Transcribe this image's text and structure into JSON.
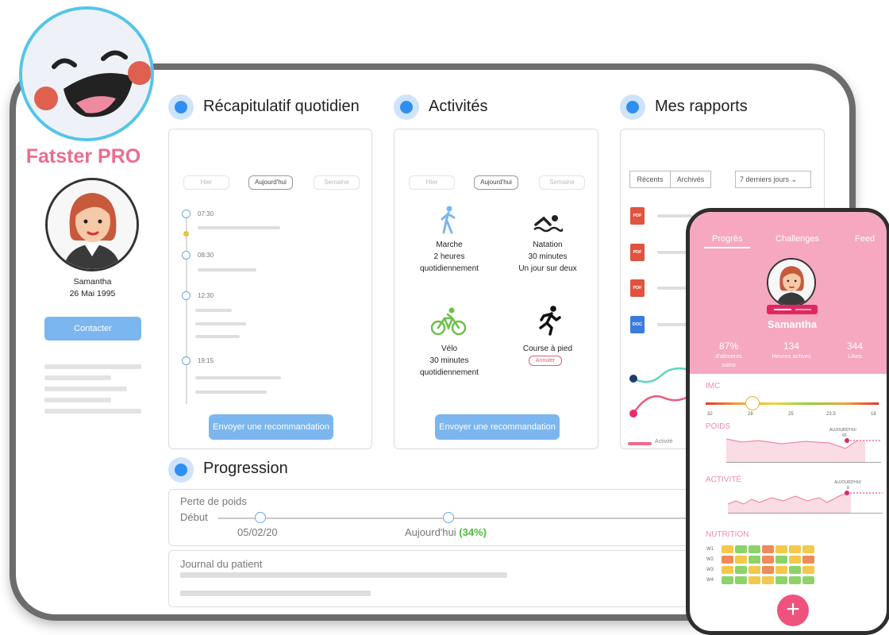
{
  "brand": {
    "name": "Fatster PRO"
  },
  "patient": {
    "name": "Samantha",
    "birthdate": "26 Mai 1995",
    "contact_label": "Contacter"
  },
  "sections": {
    "daily": "Récapitulatif quotidien",
    "activities": "Activités",
    "reports": "Mes rapports",
    "progression": "Progression"
  },
  "daily": {
    "pills": [
      "Hier",
      "Aujourd'hui",
      "Semaine"
    ],
    "times": [
      "07:30",
      "08:30",
      "12:30",
      "19:15"
    ],
    "button": "Envoyer une recommandation"
  },
  "activities": {
    "pills": [
      "Hier",
      "Aujourd'hui",
      "Semaine"
    ],
    "items": [
      {
        "name": "Marche",
        "line1": "2 heures",
        "line2": "quotidiennement",
        "icon": "walking-icon"
      },
      {
        "name": "Natation",
        "line1": "30 minutes",
        "line2": "Un jour sur deux",
        "icon": "swimming-icon"
      },
      {
        "name": "Vélo",
        "line1": "30 minutes",
        "line2": "quotidiennement",
        "icon": "cycling-icon"
      },
      {
        "name": "Course à pied",
        "line1": "Annuler",
        "line2": "",
        "icon": "running-icon"
      }
    ],
    "button": "Envoyer une recommandation"
  },
  "reports": {
    "tabs": [
      "Récents",
      "Archivés"
    ],
    "period": "7 derniers jours",
    "files": [
      "PDF",
      "PDF",
      "PDF",
      "DOC"
    ],
    "legend": "Activité"
  },
  "progression": {
    "weight_label": "Perte de poids",
    "start_label": "Début",
    "start_date": "05/02/20",
    "today_label": "Aujourd'hui",
    "today_pct": "(34%)",
    "journal_label": "Journal du patient"
  },
  "phone": {
    "tabs": [
      "Progrès",
      "Challenges",
      "Feed"
    ],
    "name": "Samantha",
    "stats": [
      {
        "value": "87%",
        "label": "d'aliments sains"
      },
      {
        "value": "134",
        "label": "Heures actives"
      },
      {
        "value": "344",
        "label": "Likes"
      }
    ],
    "imc": {
      "title": "IMC",
      "ticks": [
        "32",
        "28",
        "25",
        "23.5",
        "18"
      ]
    },
    "poids": {
      "title": "POIDS",
      "marker": "AUJOURD'HUI",
      "value": "65"
    },
    "activite": {
      "title": "ACTIVITÉ",
      "marker": "AUJOURD'HUI",
      "value": "8"
    },
    "nutrition": {
      "title": "NUTRITION",
      "weeks": [
        "W1",
        "W2",
        "W3",
        "W4"
      ],
      "grid": [
        [
          "#f2c94c",
          "#8dd36a",
          "#8dd36a",
          "#ef8a5a",
          "#f2c94c",
          "#f2c94c",
          "#f2c94c"
        ],
        [
          "#ef8a5a",
          "#f2c94c",
          "#8dd36a",
          "#ef8a5a",
          "#8dd36a",
          "#f2c94c",
          "#ef8a5a"
        ],
        [
          "#f2c94c",
          "#8dd36a",
          "#f2c94c",
          "#ef8a5a",
          "#f2c94c",
          "#8dd36a",
          "#f2c94c"
        ],
        [
          "#8dd36a",
          "#8dd36a",
          "#f2c94c",
          "#f2c94c",
          "#8dd36a",
          "#8dd36a",
          "#8dd36a"
        ]
      ]
    }
  },
  "colors": {
    "accent_blue": "#2f8ff0",
    "button_blue": "#7cb6ee",
    "brand_pink": "#ec6c8e",
    "phone_pink": "#f5a8c0"
  }
}
